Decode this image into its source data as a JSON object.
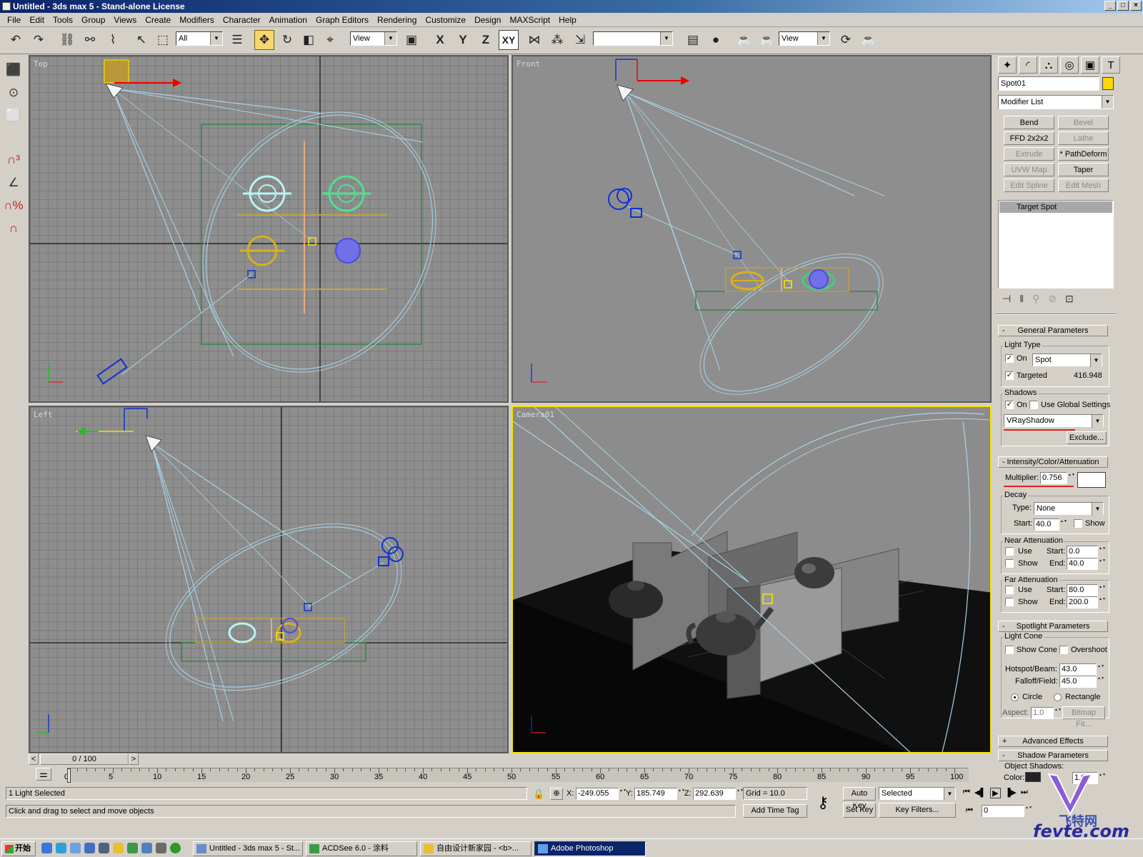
{
  "window": {
    "title": "Untitled - 3ds max 5 - Stand-alone License"
  },
  "menu": [
    "File",
    "Edit",
    "Tools",
    "Group",
    "Views",
    "Create",
    "Modifiers",
    "Character",
    "Animation",
    "Graph Editors",
    "Rendering",
    "Customize",
    "Design",
    "MAXScript",
    "Help"
  ],
  "toolbar": {
    "selection_filter": "All",
    "ref_coord": "View",
    "named_selection": "",
    "render_view": "View",
    "axes": [
      "X",
      "Y",
      "Z",
      "XY"
    ]
  },
  "viewports": {
    "top": "Top",
    "front": "Front",
    "left": "Left",
    "camera": "Camera01"
  },
  "cmd": {
    "object_name": "Spot01",
    "object_color": "#ffd800",
    "modifier_list": "Modifier List",
    "modifiers": [
      {
        "label": "Bend",
        "enabled": true
      },
      {
        "label": "Bevel",
        "enabled": false
      },
      {
        "label": "FFD 2x2x2",
        "enabled": true
      },
      {
        "label": "Lathe",
        "enabled": false
      },
      {
        "label": "Extrude",
        "enabled": false
      },
      {
        "label": "* PathDeform",
        "enabled": true
      },
      {
        "label": "UVW Map",
        "enabled": false
      },
      {
        "label": "Taper",
        "enabled": true
      },
      {
        "label": "Edit Spline",
        "enabled": false
      },
      {
        "label": "Edit Mesh",
        "enabled": false
      }
    ],
    "stack_item": "Target Spot",
    "general": {
      "header": "General Parameters",
      "light_type": "Light Type",
      "on": "On",
      "type_value": "Spot",
      "targeted": "Targeted",
      "target_dist": "416.948",
      "shadows": "Shadows",
      "shadow_on": "On",
      "use_global": "Use Global Settings",
      "shadow_type": "VRayShadow",
      "exclude": "Exclude..."
    },
    "intensity": {
      "header": "Intensity/Color/Attenuation",
      "multiplier_label": "Multiplier:",
      "multiplier": "0.756",
      "decay": "Decay",
      "type_label": "Type:",
      "type_value": "None",
      "start_label": "Start:",
      "start": "40.0",
      "show": "Show",
      "near": "Near Attenuation",
      "use": "Use",
      "near_start": "0.0",
      "end_label": "End:",
      "near_end": "40.0",
      "far": "Far Attenuation",
      "far_start": "80.0",
      "far_end": "200.0",
      "light_color": "#ffffff"
    },
    "spot": {
      "header": "Spotlight Parameters",
      "cone": "Light Cone",
      "show_cone": "Show Cone",
      "overshoot": "Overshoot",
      "hotspot_label": "Hotspot/Beam:",
      "hotspot": "43.0",
      "falloff_label": "Falloff/Field:",
      "falloff": "45.0",
      "circle": "Circle",
      "rectangle": "Rectangle",
      "aspect_label": "Aspect:",
      "aspect": "1.0",
      "bitmap_fit": "Bitmap Fit..."
    },
    "advanced": "Advanced Effects",
    "shadow_params": "Shadow Parameters",
    "object_shadows": "Object Shadows:",
    "color_label": "Color:",
    "dens_value": "1.0"
  },
  "timeline": {
    "slider": "0 / 100",
    "ticks": [
      "0",
      "5",
      "10",
      "15",
      "20",
      "25",
      "30",
      "35",
      "40",
      "45",
      "50",
      "55",
      "60",
      "65",
      "70",
      "75",
      "80",
      "85",
      "90",
      "95",
      "100"
    ]
  },
  "status": {
    "selected": "1 Light Selected",
    "prompt": "Click and drag to select and move objects",
    "x_label": "X:",
    "x": "-249.055",
    "y_label": "Y:",
    "y": "185.749",
    "z_label": "Z:",
    "z": "292.639",
    "grid": "Grid = 10.0",
    "add_time_tag": "Add Time Tag",
    "auto_key": "Auto Key",
    "set_key": "Set Key",
    "key_mode": "Selected",
    "key_filters": "Key Filters...",
    "frame": "0"
  },
  "taskbar": {
    "start": "开始",
    "tasks": [
      "Untitled - 3ds max 5 - St...",
      "ACDSee 6.0 - 涂料",
      "自由设计新家园 - <b>...",
      "Adobe Photoshop"
    ]
  },
  "watermark": {
    "cn": "飞特网",
    "url": "fevte.com"
  }
}
